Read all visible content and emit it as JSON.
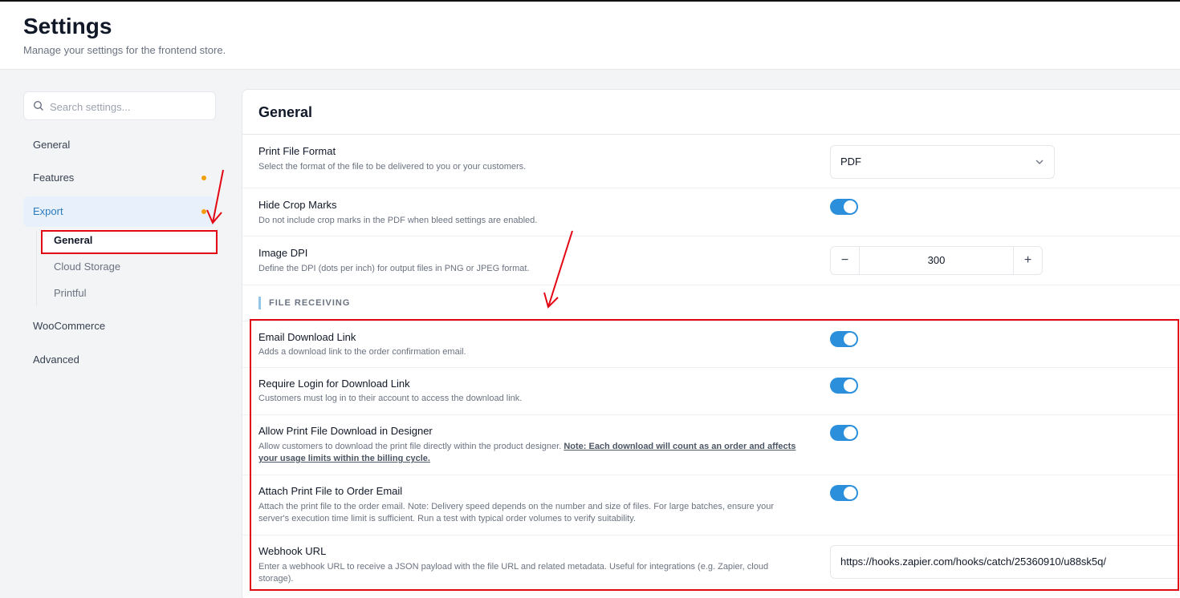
{
  "header": {
    "title": "Settings",
    "subtitle": "Manage your settings for the frontend store."
  },
  "sidebar": {
    "search_placeholder": "Search settings...",
    "items": [
      {
        "label": "General"
      },
      {
        "label": "Features"
      },
      {
        "label": "Export"
      },
      {
        "label": "WooCommerce"
      },
      {
        "label": "Advanced"
      }
    ],
    "export_sub": [
      {
        "label": "General"
      },
      {
        "label": "Cloud Storage"
      },
      {
        "label": "Printful"
      }
    ]
  },
  "panel": {
    "title": "General",
    "print_format": {
      "label": "Print File Format",
      "desc": "Select the format of the file to be delivered to you or your customers.",
      "value": "PDF"
    },
    "crop_marks": {
      "label": "Hide Crop Marks",
      "desc": "Do not include crop marks in the PDF when bleed settings are enabled.",
      "on": true
    },
    "dpi": {
      "label": "Image DPI",
      "desc": "Define the DPI (dots per inch) for output files in PNG or JPEG format.",
      "value": "300",
      "minus": "−",
      "plus": "+"
    },
    "section_label": "FILE RECEIVING",
    "email_link": {
      "label": "Email Download Link",
      "desc": "Adds a download link to the order confirmation email.",
      "on": true
    },
    "require_login": {
      "label": "Require Login for Download Link",
      "desc": "Customers must log in to their account to access the download link.",
      "on": true
    },
    "allow_designer": {
      "label": "Allow Print File Download in Designer",
      "desc": "Allow customers to download the print file directly within the product designer.",
      "note": "Note: Each download will count as an order and affects your usage limits within the billing cycle.",
      "on": true
    },
    "attach_email": {
      "label": "Attach Print File to Order Email",
      "desc": "Attach the print file to the order email. Note: Delivery speed depends on the number and size of files. For large batches, ensure your server's execution time limit is sufficient. Run a test with typical order volumes to verify suitability.",
      "on": true
    },
    "webhook": {
      "label": "Webhook URL",
      "desc": "Enter a webhook URL to receive a JSON payload with the file URL and related metadata. Useful for integrations (e.g. Zapier, cloud storage).",
      "value": "https://hooks.zapier.com/hooks/catch/25360910/u88sk5q/"
    }
  },
  "colors": {
    "accent": "#2b8fdb",
    "annotation": "#e30613",
    "feature_dot": "#f59e0b"
  }
}
